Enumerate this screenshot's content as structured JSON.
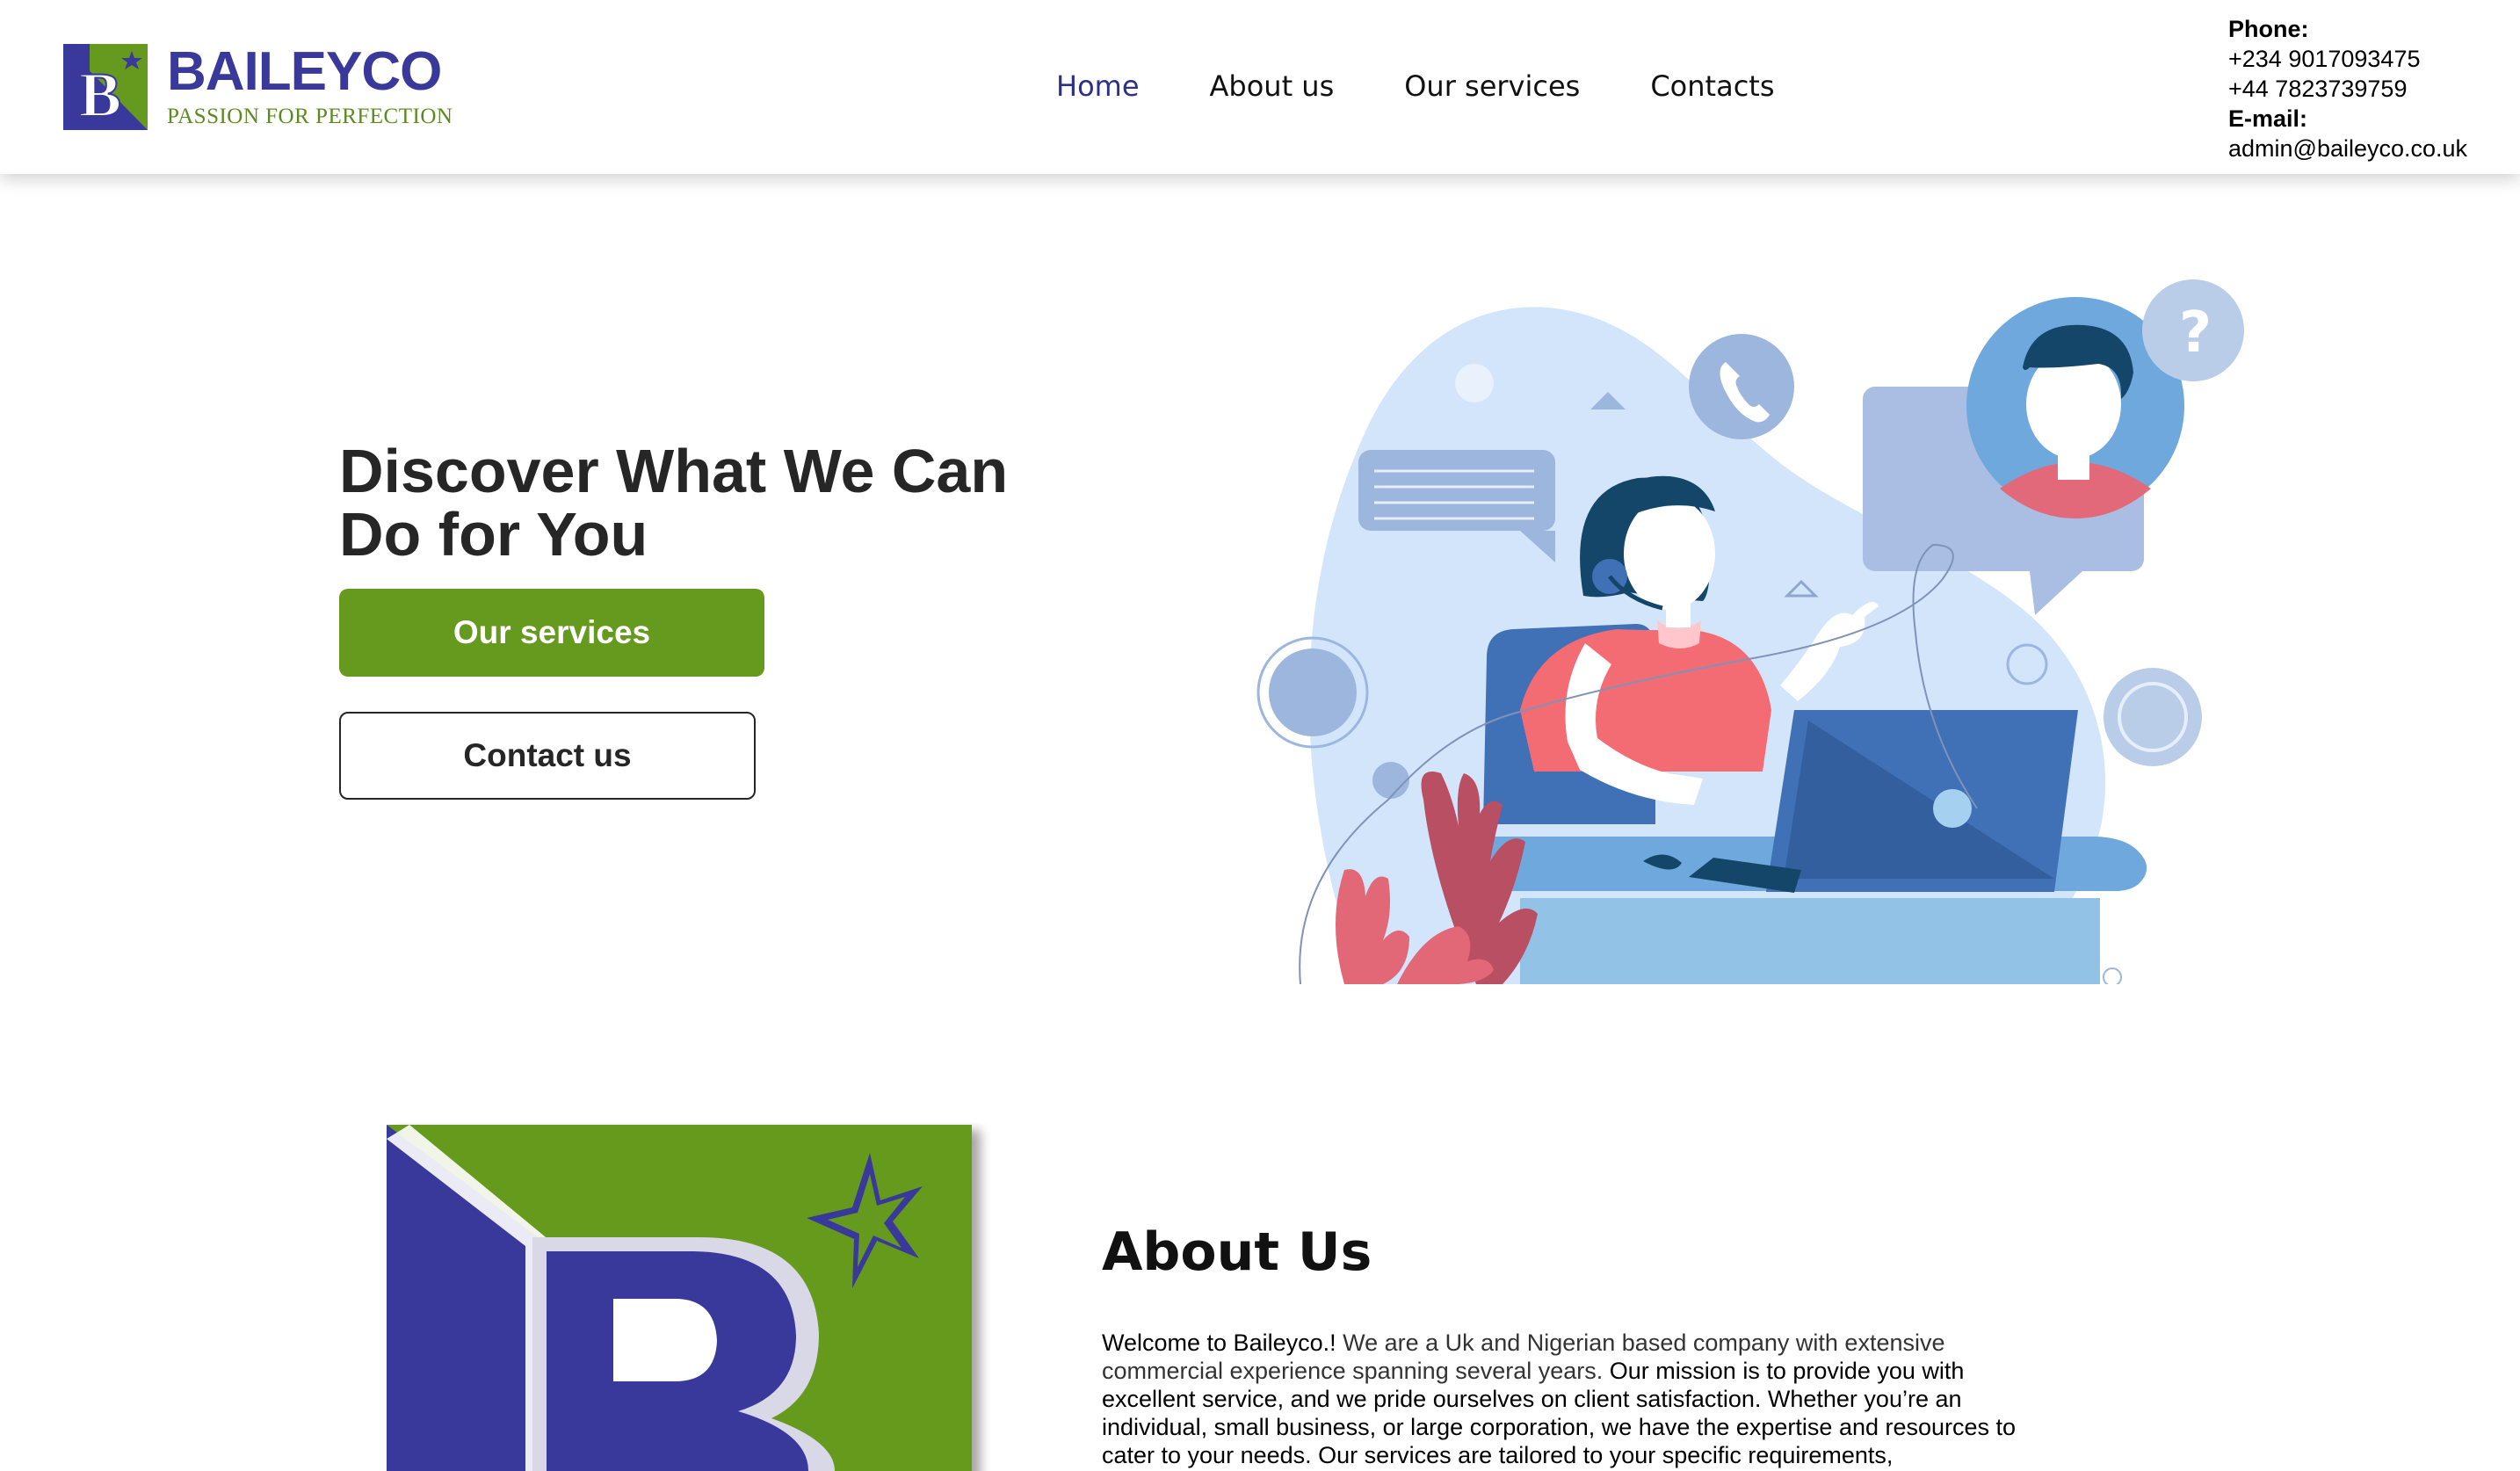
{
  "brand": {
    "name": "BAILEYCO",
    "tagline": "PASSION FOR PERFECTION",
    "colors": {
      "blue": "#38399a",
      "green": "#669a1e"
    }
  },
  "nav": {
    "items": [
      {
        "label": "Home",
        "active": true
      },
      {
        "label": "About us"
      },
      {
        "label": "Our services"
      },
      {
        "label": "Contacts"
      }
    ]
  },
  "contact": {
    "phone_label": "Phone:",
    "phone_ng": "+234 9017093475",
    "phone_uk": "+44 7823739759",
    "email_label": "E-mail:",
    "email": "admin@baileyco.co.uk"
  },
  "hero": {
    "title_line1": "Discover What We Can",
    "title_line2": "Do for You",
    "primary_button": "Our services",
    "secondary_button": "Contact us",
    "illustration": "customer-support-illustration"
  },
  "about": {
    "title": "About Us",
    "p_welcome": "Welcome to Baileyco.!",
    "p_part2": " We are a Uk and Nigerian based company with extensive commercial experience spanning several years.",
    "p_part3": " Our mission is to provide you with excellent service, and we pride ourselves on client satisfaction. Whether you’re an individual, small business, or large corporation, we have the expertise and resources to cater to your needs. Our services are tailored to your specific requirements,"
  }
}
